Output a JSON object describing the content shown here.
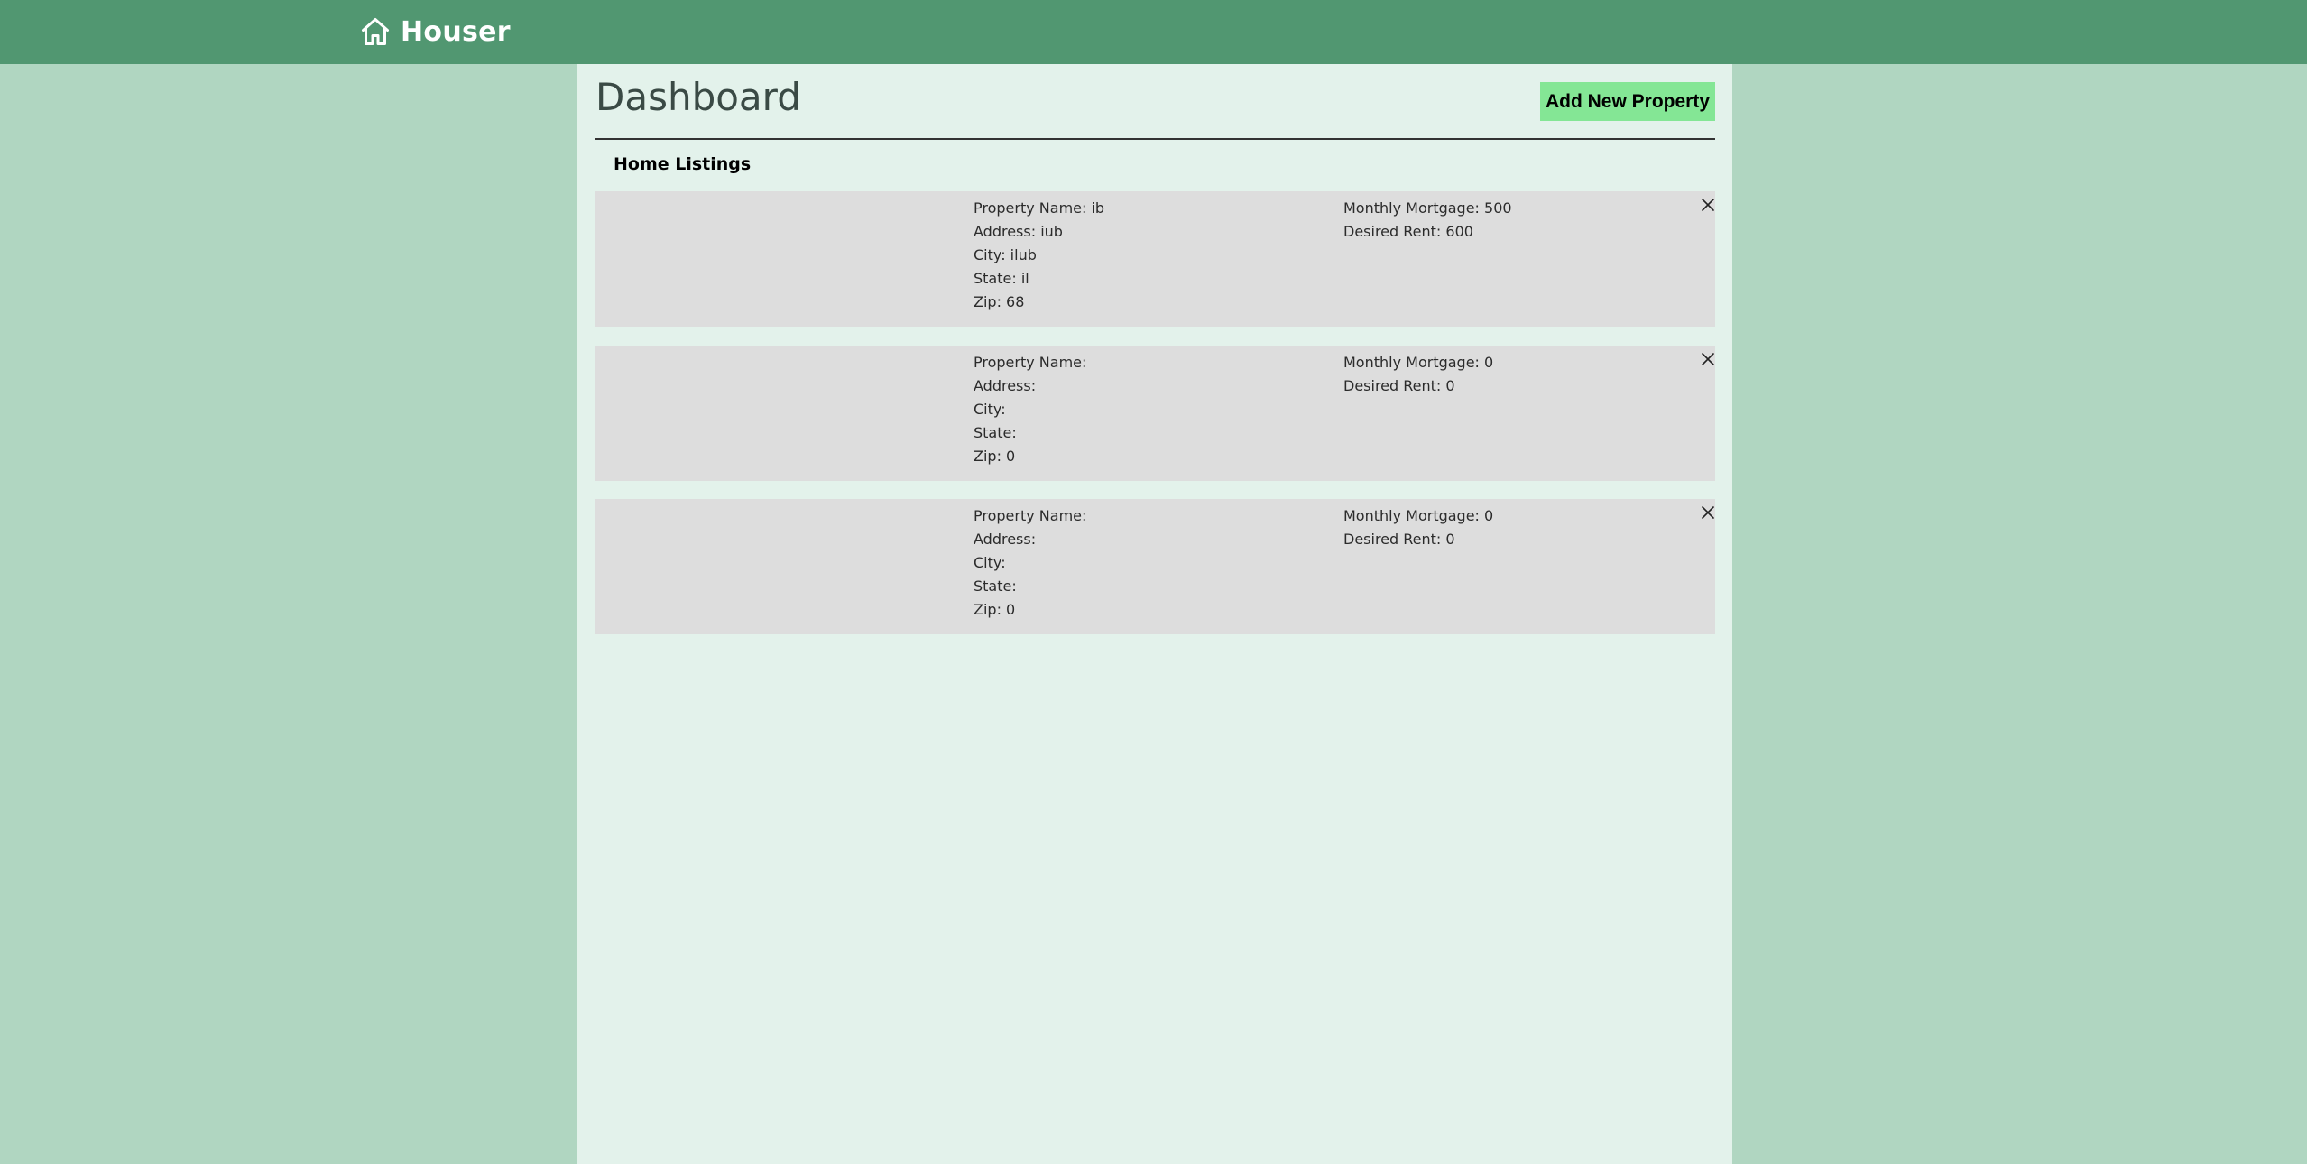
{
  "app": {
    "name": "Houser",
    "icon": "home-icon"
  },
  "colors": {
    "header": "#519771",
    "page_bg": "#b0d6c1",
    "panel_bg": "#e3f2eb",
    "card_bg": "#dddddd",
    "button_bg": "#84e695"
  },
  "dashboard": {
    "title": "Dashboard",
    "add_button_label": "Add New Property",
    "section_title": "Home Listings"
  },
  "listings": [
    {
      "name": "Property Name: ib",
      "address": "Address: iub",
      "city": "City: ilub",
      "state": "State: il",
      "zip": "Zip: 68",
      "mortgage": "Monthly Mortgage: 500",
      "rent": "Desired Rent: 600",
      "delete_icon": "close-icon"
    },
    {
      "name": "Property Name:",
      "address": "Address:",
      "city": "City:",
      "state": "State:",
      "zip": "Zip: 0",
      "mortgage": "Monthly Mortgage: 0",
      "rent": "Desired Rent: 0",
      "delete_icon": "close-icon"
    },
    {
      "name": "Property Name:",
      "address": "Address:",
      "city": "City:",
      "state": "State:",
      "zip": "Zip: 0",
      "mortgage": "Monthly Mortgage: 0",
      "rent": "Desired Rent: 0",
      "delete_icon": "close-icon"
    }
  ]
}
